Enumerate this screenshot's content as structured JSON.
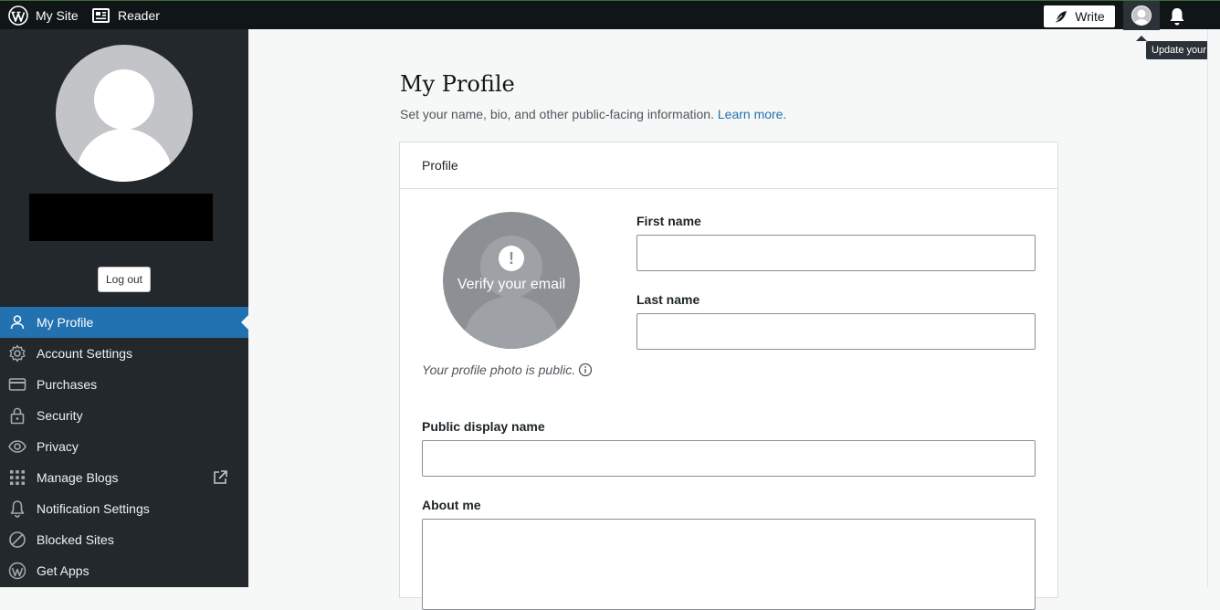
{
  "masterbar": {
    "my_site": "My Site",
    "reader": "Reader",
    "write": "Write",
    "tooltip": "Update your p"
  },
  "sidebar": {
    "logout": "Log out",
    "items": [
      {
        "label": "My Profile",
        "icon": "person-icon",
        "active": true
      },
      {
        "label": "Account Settings",
        "icon": "gear-icon"
      },
      {
        "label": "Purchases",
        "icon": "credit-card-icon"
      },
      {
        "label": "Security",
        "icon": "lock-icon"
      },
      {
        "label": "Privacy",
        "icon": "eye-icon"
      },
      {
        "label": "Manage Blogs",
        "icon": "grid-icon",
        "external": true
      },
      {
        "label": "Notification Settings",
        "icon": "bell-icon"
      },
      {
        "label": "Blocked Sites",
        "icon": "block-icon"
      },
      {
        "label": "Get Apps",
        "icon": "wordpress-icon"
      }
    ]
  },
  "main": {
    "title": "My Profile",
    "subtitle": "Set your name, bio, and other public-facing information.",
    "learn_more": "Learn more.",
    "card_title": "Profile",
    "verify_text": "Verify your email",
    "photo_note": "Your profile photo is public.",
    "fields": {
      "first_name": {
        "label": "First name",
        "value": ""
      },
      "last_name": {
        "label": "Last name",
        "value": ""
      },
      "display_name": {
        "label": "Public display name",
        "value": ""
      },
      "about_me": {
        "label": "About me",
        "value": ""
      }
    }
  },
  "colors": {
    "masterbar": "#101517",
    "sidebar": "#23282d",
    "accent": "#2271b1"
  }
}
